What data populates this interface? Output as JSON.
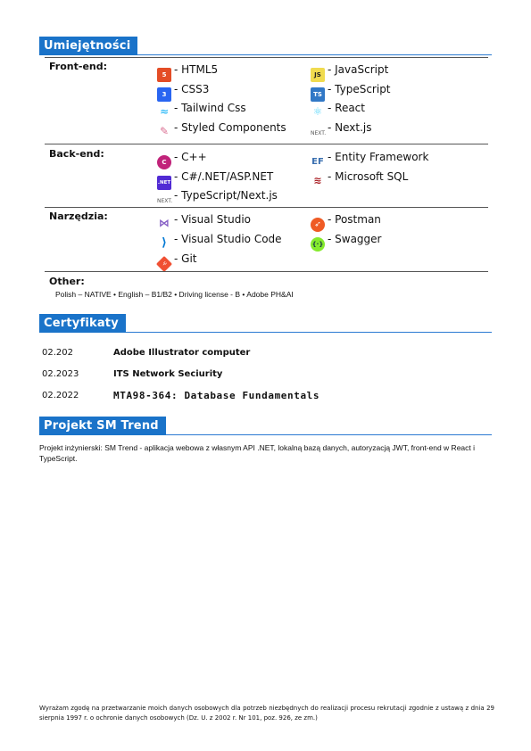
{
  "skills_section": {
    "title": "Umiejętności"
  },
  "frontend": {
    "label": "Front-end:",
    "items": [
      {
        "name": "- HTML5",
        "icon": "html5-icon"
      },
      {
        "name": "- JavaScript",
        "icon": "javascript-icon"
      },
      {
        "name": "- CSS3",
        "icon": "css3-icon"
      },
      {
        "name": "- TypeScript",
        "icon": "typescript-icon"
      },
      {
        "name": "- Tailwind Css",
        "icon": "tailwind-icon"
      },
      {
        "name": "- React",
        "icon": "react-icon"
      },
      {
        "name": "- Styled Components",
        "icon": "styled-components-icon"
      },
      {
        "name": "- Next.js",
        "icon": "nextjs-icon"
      }
    ]
  },
  "backend": {
    "label": "Back-end:",
    "items": [
      {
        "name": "- C++",
        "icon": "cpp-icon"
      },
      {
        "name": "- Entity Framework",
        "icon": "entity-framework-icon"
      },
      {
        "name": "- C#/.NET/ASP.NET",
        "icon": "dotnet-icon"
      },
      {
        "name": "- Microsoft SQL",
        "icon": "mssql-icon"
      },
      {
        "name": "- TypeScript/Next.js",
        "icon": "nextjs-icon"
      }
    ]
  },
  "tools": {
    "label": "Narzędzia:",
    "items": [
      {
        "name": "- Visual Studio",
        "icon": "visual-studio-icon"
      },
      {
        "name": "- Postman",
        "icon": "postman-icon"
      },
      {
        "name": "- Visual Studio Code",
        "icon": "vscode-icon"
      },
      {
        "name": "- Swagger",
        "icon": "swagger-icon"
      },
      {
        "name": "- Git",
        "icon": "git-icon"
      }
    ]
  },
  "other": {
    "label": "Other:",
    "text": "Polish – NATIVE • English – B1/B2 • Driving license - B • Adobe PH&AI"
  },
  "certs_section": {
    "title": "Certyfikaty"
  },
  "certificates": [
    {
      "date": "02.202",
      "name": "Adobe Illustrator computer"
    },
    {
      "date": "02.2023",
      "name": "ITS Network Seciurity"
    },
    {
      "date": "02.2022",
      "name": "MTA98-364: Database Fundamentals"
    }
  ],
  "project_section": {
    "title": "Projekt SM Trend"
  },
  "project": {
    "text": "Projekt inżynierski: SM Trend - aplikacja webowa z własnym API .NET, lokalną bazą danych, autoryzacją JWT, front-end w React i TypeScript."
  },
  "consent": {
    "text": "Wyrażam zgodę na przetwarzanie moich danych osobowych dla potrzeb niezbędnych do realizacji procesu rekrutacji zgodnie z ustawą z dnia 29 sierpnia 1997 r. o ochronie danych osobowych (Dz. U. z 2002 r. Nr 101, poz. 926, ze zm.)"
  },
  "colors": {
    "accent": "#1a73c9",
    "line": "#2a7ad2"
  }
}
